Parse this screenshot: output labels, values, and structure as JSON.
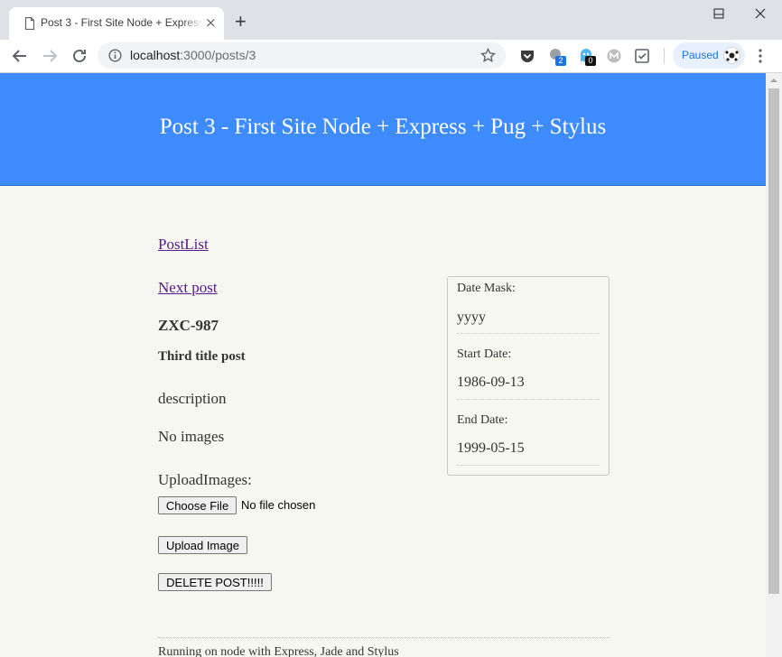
{
  "browser": {
    "tab_title": "Post 3 - First Site Node + Express + Pug + Stylus",
    "tab_close": "×",
    "new_tab": "+",
    "url_host": "localhost",
    "url_path": ":3000/posts/3",
    "profile_status": "Paused",
    "ext_badge_1": "2",
    "ext_badge_2": "0"
  },
  "page": {
    "header_title": "Post 3 - First Site Node + Express + Pug + Stylus",
    "postlist_link": "PostList",
    "next_post_link": "Next post",
    "post_code": "ZXC-987",
    "post_title": "Third title post",
    "description": "description",
    "images_status": "No images",
    "upload_label": "UploadImages:",
    "choose_file_label": "Choose File",
    "no_file_text": "No file chosen",
    "upload_button": "Upload Image",
    "delete_button": "DELETE POST!!!!!",
    "dates": {
      "mask_label": "Date Mask:",
      "mask_value": "yyyy",
      "start_label": "Start Date:",
      "start_value": "1986-09-13",
      "end_label": "End Date:",
      "end_value": "1999-05-15"
    },
    "footer": "Running on node with Express, Jade and Stylus"
  },
  "colors": {
    "header_bg": "#3d8bfd",
    "page_bg": "#f7f7f1",
    "link": "#551a8b"
  }
}
